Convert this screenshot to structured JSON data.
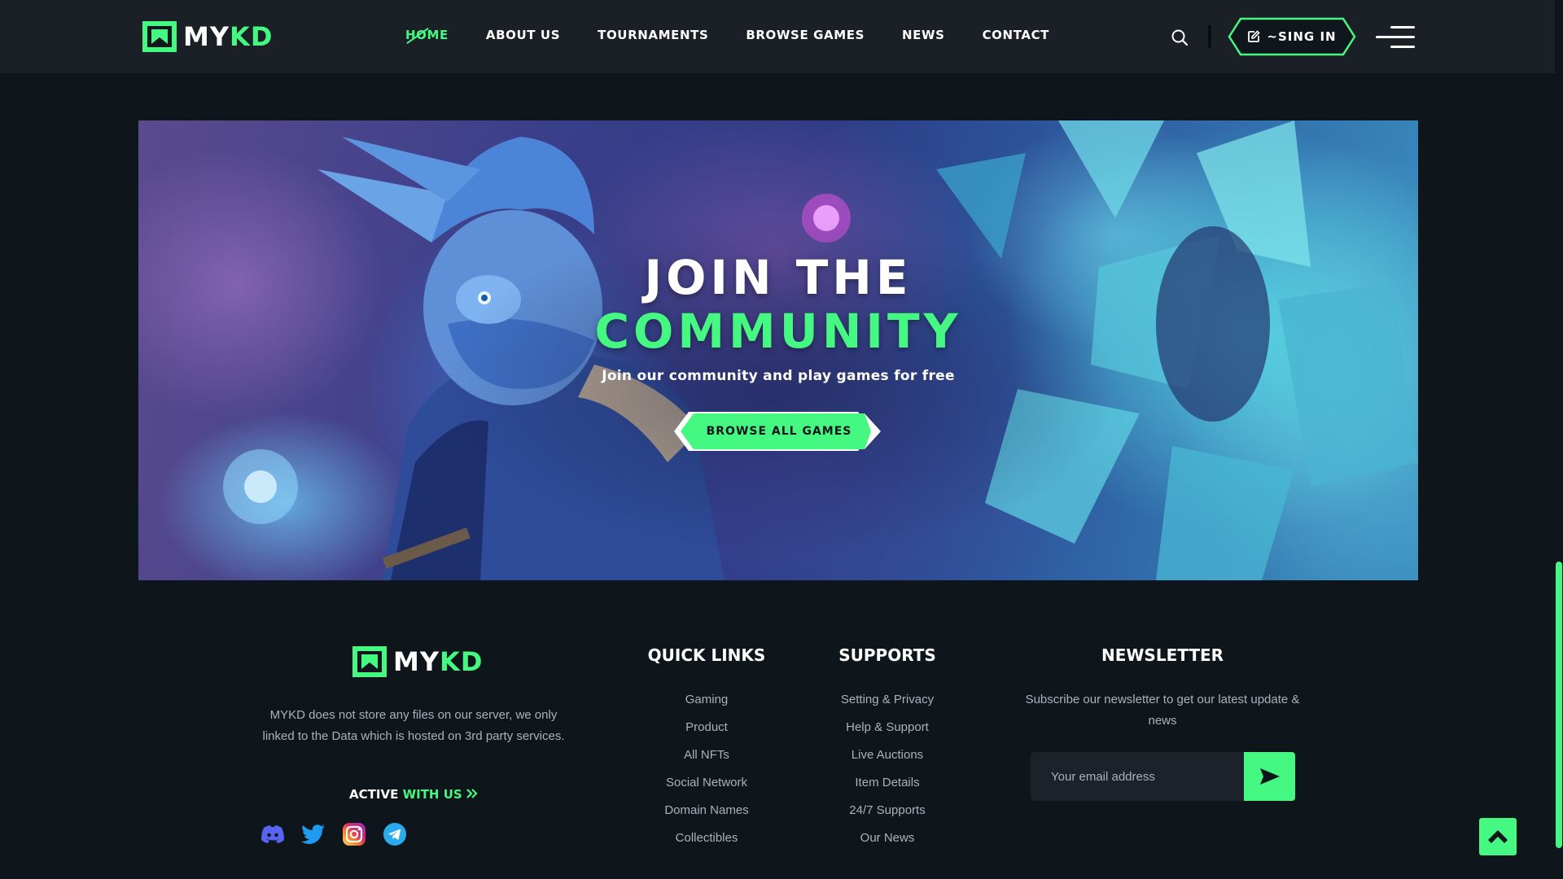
{
  "brand": {
    "name_part1": "MY",
    "name_part2": "KD",
    "accent_color": "#45f882",
    "background_color": "#0f161b"
  },
  "header": {
    "nav": [
      {
        "label": "HOME",
        "active": true
      },
      {
        "label": "ABOUT US",
        "active": false
      },
      {
        "label": "TOURNAMENTS",
        "active": false
      },
      {
        "label": "BROWSE GAMES",
        "active": false
      },
      {
        "label": "NEWS",
        "active": false
      },
      {
        "label": "CONTACT",
        "active": false
      }
    ],
    "search_icon": "search-icon",
    "signin_label": "~SING IN",
    "signin_icon": "edit-icon",
    "menu_icon": "hamburger-menu-icon"
  },
  "hero": {
    "title_line1": "JOIN THE",
    "title_line2": "COMMUNITY",
    "subtitle": "Join our community and play games for free",
    "button_label": "BROWSE ALL GAMES"
  },
  "footer": {
    "about_text": "MYKD does not store any files on our server, we only linked to the Data which is hosted on 3rd party services.",
    "active_label": "ACTIVE",
    "with_us_label": "WITH US",
    "socials": [
      "discord-icon",
      "twitter-icon",
      "instagram-icon",
      "telegram-icon"
    ],
    "quick_links": {
      "title": "QUICK LINKS",
      "items": [
        "Gaming",
        "Product",
        "All NFTs",
        "Social Network",
        "Domain Names",
        "Collectibles"
      ]
    },
    "supports": {
      "title": "SUPPORTS",
      "items": [
        "Setting & Privacy",
        "Help & Support",
        "Live Auctions",
        "Item Details",
        "24/7 Supports",
        "Our News"
      ]
    },
    "newsletter": {
      "title": "NEWSLETTER",
      "text": "Subscribe our newsletter to get our latest update & news",
      "placeholder": "Your email address",
      "submit_icon": "send-icon"
    }
  },
  "scroll_top_icon": "chevron-up-icon"
}
